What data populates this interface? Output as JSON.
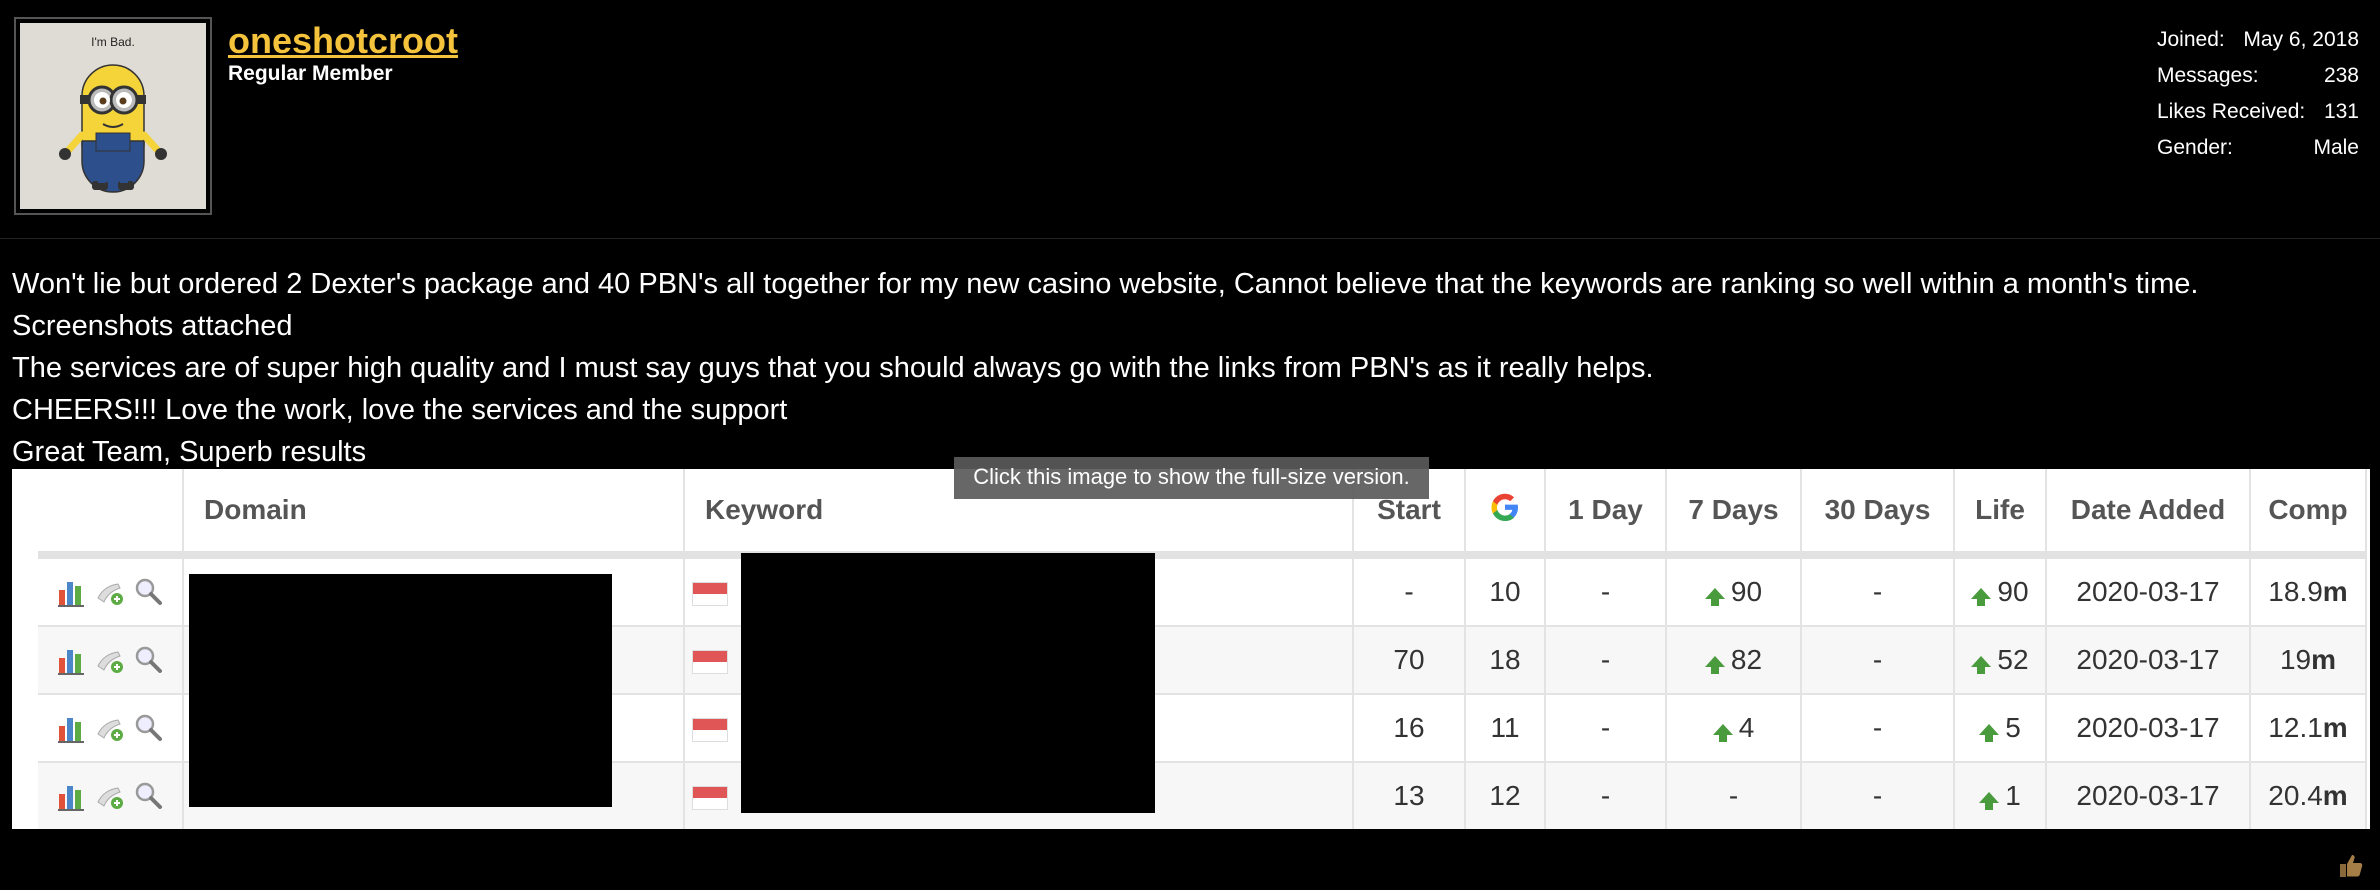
{
  "user": {
    "username": "oneshotcroot",
    "title": "Regular Member",
    "avatar_caption": "I'm Bad.",
    "stats": [
      {
        "label": "Joined:",
        "value": "May 6, 2018"
      },
      {
        "label": "Messages:",
        "value": "238"
      },
      {
        "label": "Likes Received:",
        "value": "131"
      },
      {
        "label": "Gender:",
        "value": "Male"
      }
    ]
  },
  "post": {
    "lines": [
      "Won't lie but ordered 2 Dexter's package and 40 PBN's all together for my new casino website, Cannot believe that the keywords are ranking so well within a month's time.",
      "Screenshots attached",
      "The services are of super high quality and I must say guys that you should always go with the links from PBN's as it really helps.",
      "CHEERS!!! Love the work, love the services and the support",
      "Great Team, Superb results"
    ]
  },
  "attachment": {
    "tooltip": "Click this image to show the full-size version.",
    "headers": {
      "domain": "Domain",
      "keyword": "Keyword",
      "start": "Start",
      "google": "G",
      "day1": "1 Day",
      "days7": "7 Days",
      "days30": "30 Days",
      "life": "Life",
      "date_added": "Date Added",
      "comp": "Comp"
    },
    "rows": [
      {
        "start": "-",
        "google": "10",
        "day1": "-",
        "days7": "90",
        "days7_up": true,
        "days30": "-",
        "life": "90",
        "life_up": true,
        "date": "2020-03-17",
        "comp_num": "18.9",
        "comp_unit": "m"
      },
      {
        "start": "70",
        "google": "18",
        "day1": "-",
        "days7": "82",
        "days7_up": true,
        "days30": "-",
        "life": "52",
        "life_up": true,
        "date": "2020-03-17",
        "comp_num": "19",
        "comp_unit": "m"
      },
      {
        "start": "16",
        "google": "11",
        "day1": "-",
        "days7": "4",
        "days7_up": true,
        "days30": "-",
        "life": "5",
        "life_up": true,
        "date": "2020-03-17",
        "comp_num": "12.1",
        "comp_unit": "m"
      },
      {
        "start": "13",
        "google": "12",
        "day1": "-",
        "days7": "-",
        "days7_up": false,
        "days30": "-",
        "life": "1",
        "life_up": true,
        "date": "2020-03-17",
        "comp_num": "20.4",
        "comp_unit": "m"
      }
    ]
  },
  "icons": {
    "row_actions": [
      "bar-chart-icon",
      "add-note-icon",
      "magnifier-icon"
    ],
    "google": "google-logo-icon",
    "flag": "flag-icon",
    "trend": "up-arrow-icon",
    "like": "thumbs-up-icon"
  }
}
